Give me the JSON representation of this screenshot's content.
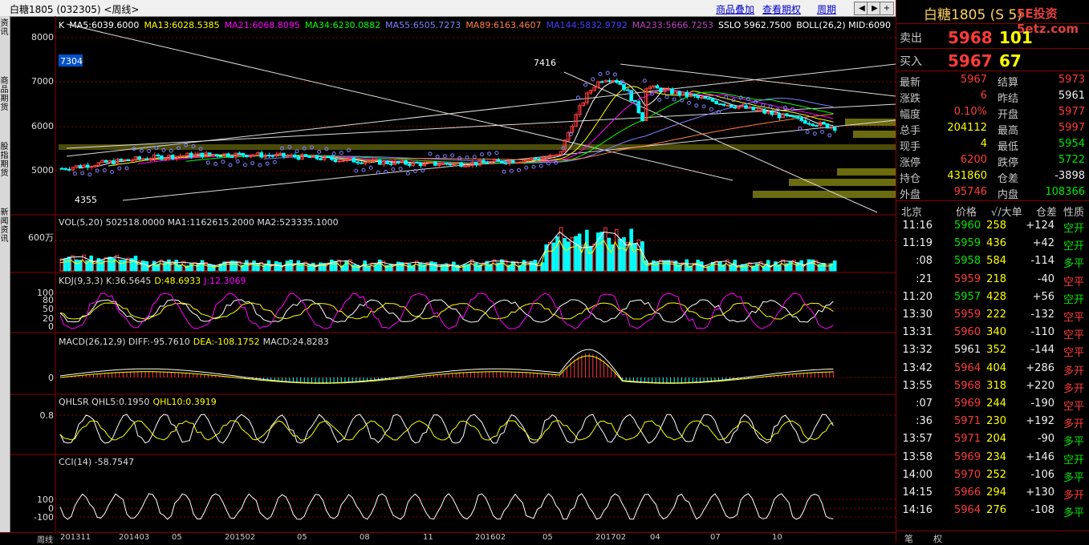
{
  "window": {
    "title": "白糖1805 (032305) <周线>",
    "links": [
      "商品叠加",
      "查看期权",
      "周期"
    ],
    "nav_icons": [
      "prev-icon",
      "next-icon",
      "zoom-in-icon",
      "zoom-out-icon"
    ]
  },
  "left_tabs": [
    "资讯",
    "商品期货",
    "股指期货",
    "新闻资讯"
  ],
  "main_panel": {
    "indicator_line": [
      {
        "text": "K",
        "color": "#ffffff"
      },
      {
        "text": "MA5:6039.6000",
        "color": "#ffffff"
      },
      {
        "text": "MA13:6028.5385",
        "color": "#ffff00"
      },
      {
        "text": "MA21:6068.8095",
        "color": "#ff00ff"
      },
      {
        "text": "MA34:6230.0882",
        "color": "#00ff00"
      },
      {
        "text": "MA55:6505.7273",
        "color": "#8080ff"
      },
      {
        "text": "MA89:6163.4607",
        "color": "#ff8040"
      },
      {
        "text": "MA144:5832.9792",
        "color": "#4040ff"
      },
      {
        "text": "MA233:5666.7253",
        "color": "#c040c0"
      },
      {
        "text": "SSLO 5962.7500",
        "color": "#ffffff"
      },
      {
        "text": "BOLL(26,2) MID:6090",
        "color": "#ffffff"
      }
    ],
    "y_ticks": [
      "8000",
      "7000",
      "6000",
      "5000"
    ],
    "current_tag": "7304",
    "high_label": "7416",
    "low_label": "4355"
  },
  "vol_panel": {
    "label": "VOL(5,20) 502518.0000 MA1:1162615.2000 MA2:523335.1000",
    "y_tick": "600万"
  },
  "kdj_panel": {
    "label_prefix": "KDJ(9,3,3) K:36.5645",
    "d_label": "D:48.6933",
    "j_label": "J:12.3069",
    "y_ticks": [
      "100",
      "80",
      "50",
      "20",
      "0"
    ]
  },
  "macd_panel": {
    "label_prefix": "MACD(26,12,9) DIFF:-95.7610",
    "dea_label": "DEA:-108.1752",
    "macd_label": "MACD:24.8283",
    "y_tick": "0"
  },
  "qhlsr_panel": {
    "label_prefix": "QHLSR QHL5:0.1950",
    "qhl10_label": "QHL10:0.3919",
    "y_tick": "0.8"
  },
  "cci_panel": {
    "label": "CCI(14) -58.7547",
    "y_ticks": [
      "100",
      "0",
      "-100"
    ]
  },
  "x_axis": {
    "cycle_label": "周线",
    "dates": [
      "201311",
      "201403",
      "05",
      "201502",
      "05",
      "08",
      "11",
      "201602",
      "05",
      "201702",
      "04",
      "07",
      "10"
    ]
  },
  "quote": {
    "header": "白糖1805 (S    5)",
    "watermark": "5E投资 5etz.com",
    "sell": {
      "label": "卖出",
      "price": "5968",
      "vol": "101"
    },
    "buy": {
      "label": "买入",
      "price": "5967",
      "vol": "67"
    },
    "stats": [
      {
        "l1": "最新",
        "v1": "5967",
        "c1": "red",
        "l2": "结算",
        "v2": "5973",
        "c2": "red"
      },
      {
        "l1": "涨跌",
        "v1": "6",
        "c1": "red",
        "l2": "昨结",
        "v2": "5961",
        "c2": "white"
      },
      {
        "l1": "幅度",
        "v1": "0.10%",
        "c1": "red",
        "l2": "开盘",
        "v2": "5977",
        "c2": "red"
      },
      {
        "l1": "总手",
        "v1": "204112",
        "c1": "yellow",
        "l2": "最高",
        "v2": "5997",
        "c2": "red"
      },
      {
        "l1": "现手",
        "v1": "4",
        "c1": "yellow",
        "l2": "最低",
        "v2": "5954",
        "c2": "green"
      },
      {
        "l1": "涨停",
        "v1": "6200",
        "c1": "red",
        "l2": "跌停",
        "v2": "5722",
        "c2": "green"
      },
      {
        "l1": "持仓",
        "v1": "431860",
        "c1": "yellow",
        "l2": "仓差",
        "v2": "-3898",
        "c2": "white"
      },
      {
        "l1": "外盘",
        "v1": "95746",
        "c1": "red",
        "l2": "内盘",
        "v2": "108366",
        "c2": "green"
      }
    ],
    "tick_headers": [
      "北京",
      "价格",
      "√/大单",
      "仓差",
      "性质"
    ],
    "ticks": [
      {
        "time": "11:16",
        "price": "5960",
        "pc": "green",
        "vol": "258",
        "diff": "+124",
        "nature": "空开",
        "nc": "green"
      },
      {
        "time": "11:19",
        "price": "5959",
        "pc": "green",
        "vol": "436",
        "diff": "+42",
        "nature": "空开",
        "nc": "green"
      },
      {
        "time": ":08",
        "price": "5958",
        "pc": "green",
        "vol": "584",
        "diff": "-114",
        "nature": "多平",
        "nc": "green"
      },
      {
        "time": ":21",
        "price": "5959",
        "pc": "red",
        "vol": "218",
        "diff": "-40",
        "nature": "空平",
        "nc": "red"
      },
      {
        "time": "11:20",
        "price": "5957",
        "pc": "green",
        "vol": "428",
        "diff": "+56",
        "nature": "空开",
        "nc": "green"
      },
      {
        "time": "13:30",
        "price": "5959",
        "pc": "red",
        "vol": "222",
        "diff": "-132",
        "nature": "空平",
        "nc": "red"
      },
      {
        "time": "13:31",
        "price": "5960",
        "pc": "red",
        "vol": "340",
        "diff": "-110",
        "nature": "空平",
        "nc": "red"
      },
      {
        "time": "13:32",
        "price": "5961",
        "pc": "white",
        "vol": "352",
        "diff": "-144",
        "nature": "空平",
        "nc": "red"
      },
      {
        "time": "13:42",
        "price": "5964",
        "pc": "red",
        "vol": "404",
        "diff": "+286",
        "nature": "多开",
        "nc": "red"
      },
      {
        "time": "13:55",
        "price": "5968",
        "pc": "red",
        "vol": "318",
        "diff": "+220",
        "nature": "多开",
        "nc": "red"
      },
      {
        "time": ":07",
        "price": "5969",
        "pc": "red",
        "vol": "244",
        "diff": "-190",
        "nature": "空平",
        "nc": "red"
      },
      {
        "time": ":36",
        "price": "5971",
        "pc": "red",
        "vol": "230",
        "diff": "+192",
        "nature": "多开",
        "nc": "red"
      },
      {
        "time": "13:57",
        "price": "5971",
        "pc": "red",
        "vol": "204",
        "diff": "-90",
        "nature": "多平",
        "nc": "green"
      },
      {
        "time": "13:58",
        "price": "5969",
        "pc": "red",
        "vol": "234",
        "diff": "+146",
        "nature": "空开",
        "nc": "green"
      },
      {
        "time": "14:00",
        "price": "5970",
        "pc": "red",
        "vol": "252",
        "diff": "-106",
        "nature": "多平",
        "nc": "green"
      },
      {
        "time": "14:15",
        "price": "5966",
        "pc": "red",
        "vol": "294",
        "diff": "+130",
        "nature": "多开",
        "nc": "red"
      },
      {
        "time": "14:16",
        "price": "5964",
        "pc": "red",
        "vol": "276",
        "diff": "-108",
        "nature": "多平",
        "nc": "green"
      }
    ],
    "bottom_tabs": [
      "笔",
      "权"
    ]
  },
  "colors": {
    "up": "#ff3b3b",
    "down": "#00ffff",
    "grid": "#8b0000"
  }
}
